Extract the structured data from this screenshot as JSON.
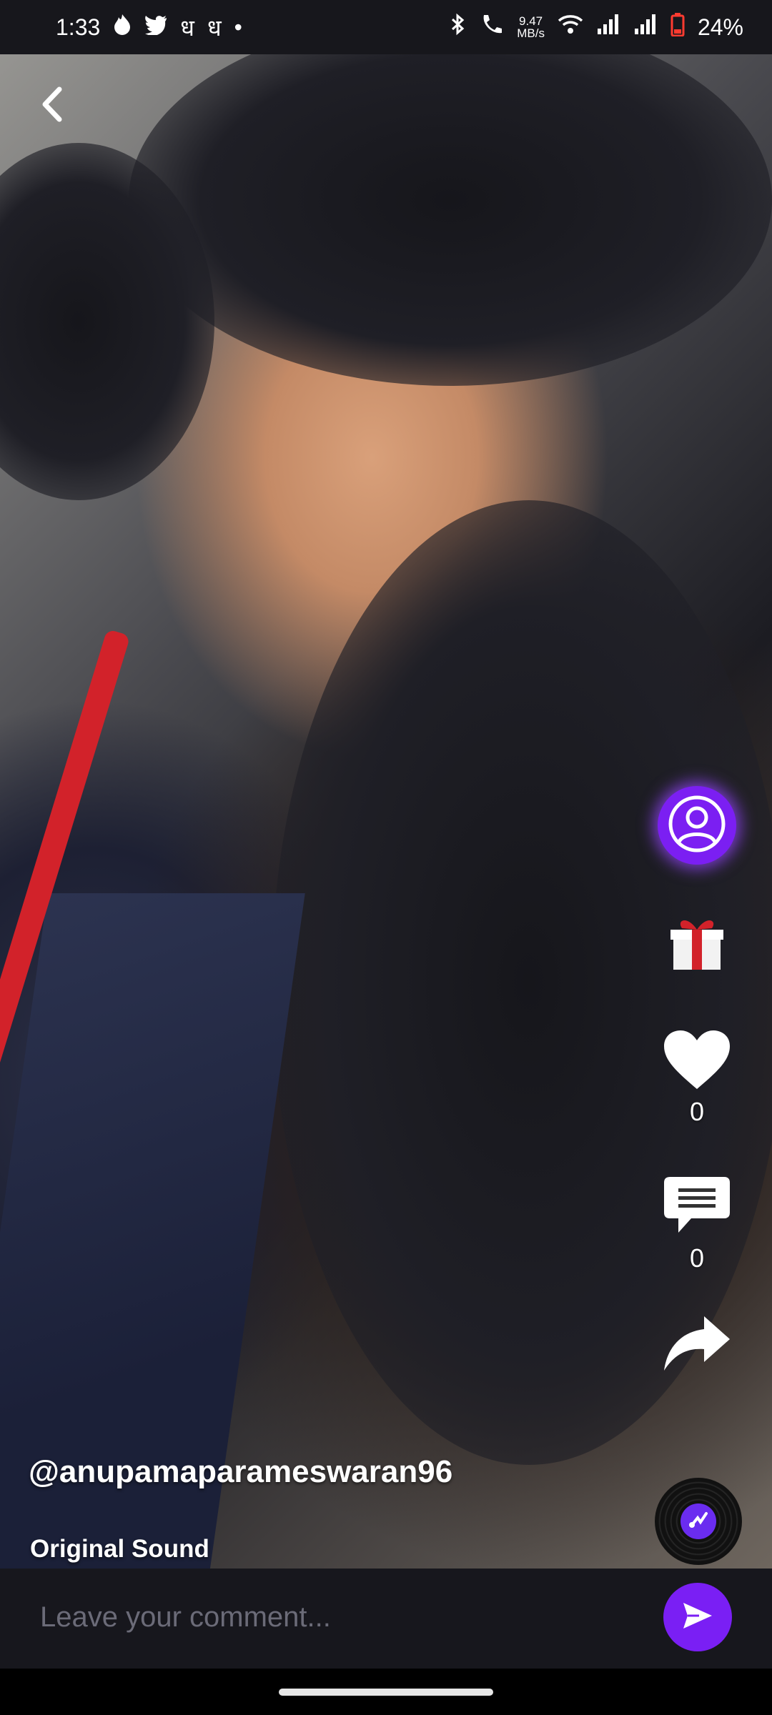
{
  "status_bar": {
    "time": "1:33",
    "notif_symbols": [
      "ध",
      "ध",
      "•"
    ],
    "speed_value": "9.47",
    "speed_unit": "MB/s",
    "battery": "24%"
  },
  "video": {
    "username": "@anupamaparameswaran96",
    "sound_label": "Original Sound"
  },
  "actions": {
    "like_count": "0",
    "comment_count": "0"
  },
  "comment": {
    "placeholder": "Leave your comment..."
  },
  "colors": {
    "accent": "#7a1ff4",
    "bar_background": "#17171d"
  }
}
